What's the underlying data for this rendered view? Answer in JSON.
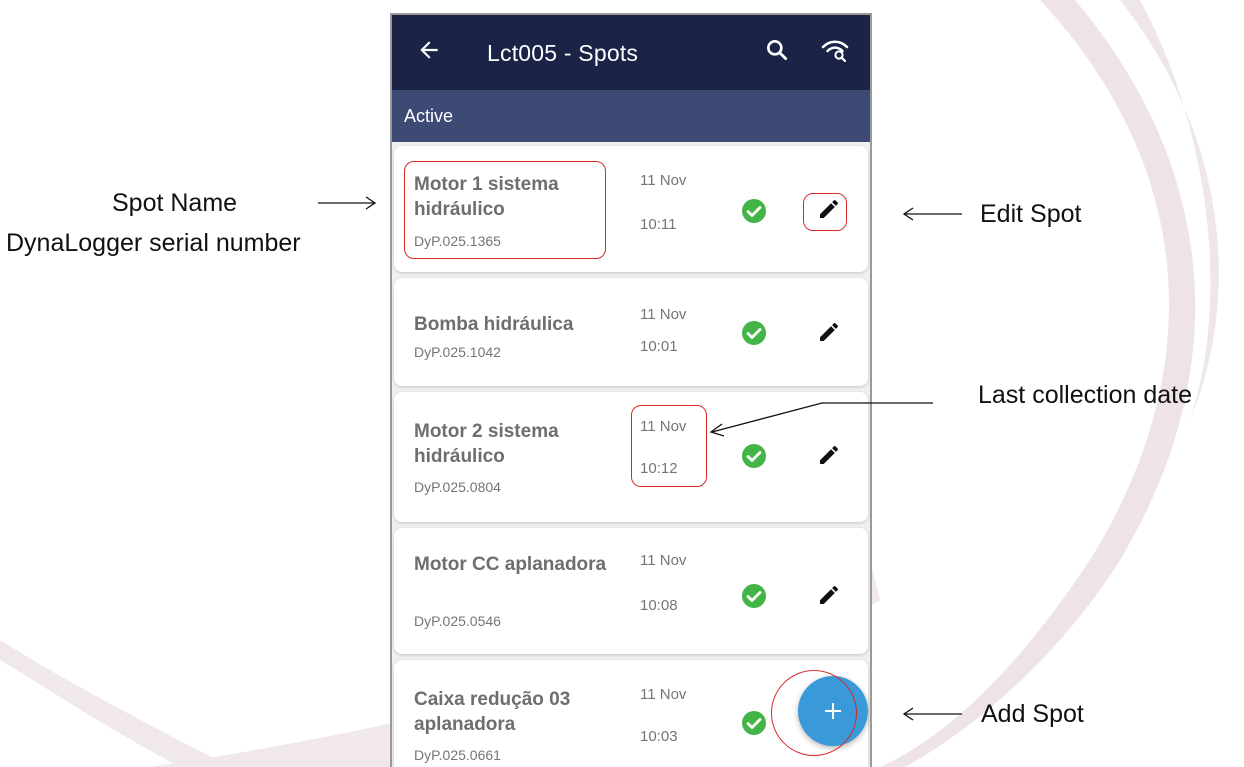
{
  "appbar": {
    "title": "Lct005 - Spots",
    "back_icon": "arrow-left-icon",
    "search_icon": "search-icon",
    "wifi_icon": "wifi-search-icon",
    "background": "#1b2447"
  },
  "section": {
    "label": "Active",
    "background": "#3c4a74"
  },
  "spots": [
    {
      "name": "Motor 1 sistema hidráulico",
      "serial": "DyP.025.1365",
      "date": "11 Nov",
      "time": "10:11",
      "status": "ok"
    },
    {
      "name": "Bomba hidráulica",
      "serial": "DyP.025.1042",
      "date": "11 Nov",
      "time": "10:01",
      "status": "ok"
    },
    {
      "name": "Motor 2 sistema hidráulico",
      "serial": "DyP.025.0804",
      "date": "11 Nov",
      "time": "10:12",
      "status": "ok"
    },
    {
      "name": "Motor CC aplanadora",
      "serial": "DyP.025.0546",
      "date": "11 Nov",
      "time": "10:08",
      "status": "ok"
    },
    {
      "name": "Caixa redução 03 aplanadora",
      "serial": "DyP.025.0661",
      "date": "11 Nov",
      "time": "10:03",
      "status": "ok"
    }
  ],
  "fab": {
    "icon": "plus-icon",
    "color": "#3a9ad9"
  },
  "annotations": {
    "spot_name": "Spot Name",
    "serial_number": "DynaLogger serial number",
    "edit_spot": "Edit Spot",
    "last_collection": "Last collection date",
    "add_spot": "Add Spot"
  },
  "colors": {
    "check_green": "#43b547",
    "annotation_red": "#d82a2a"
  }
}
